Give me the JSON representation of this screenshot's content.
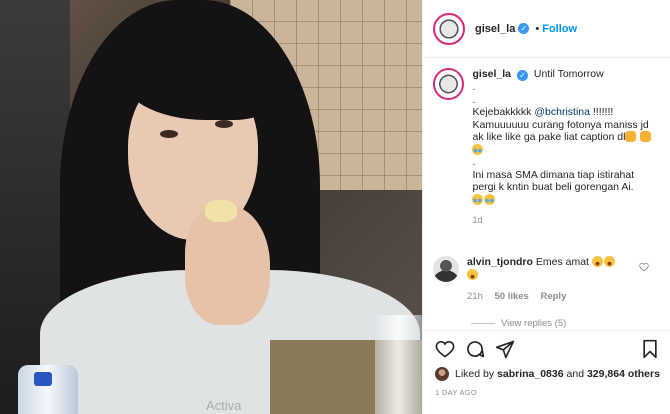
{
  "post": {
    "username": "gisel_la",
    "follow_label": "Follow",
    "dot": "•",
    "verified_mark": "✓"
  },
  "caption": {
    "username": "gisel_la",
    "line1": "Until Tomorrow",
    "dot1": ".",
    "dot2": ".",
    "text_a_pre": "Kejebakkkkk ",
    "mention": "@bchristina",
    "text_a_post": " !!!!!!! Kamuuuuuu curang fotonya maniss jd ak like like ga pake liat caption dl",
    "dot3": ".",
    "text_b": "Ini masa SMA dimana tiap istirahat pergi k kntin buat beli gorengan Ai.",
    "time": "1d"
  },
  "comment": {
    "username": "alvin_tjondro",
    "text": "Emes amat",
    "time": "21h",
    "likes": "50 likes",
    "reply": "Reply"
  },
  "view_replies": "View replies (5)",
  "likes": {
    "liked_by": "Liked by",
    "user": "sabrina_0836",
    "and": "and",
    "others": "329,864 others"
  },
  "posted_ago": "1 DAY AGO",
  "watermark": "Activa",
  "icons": [
    "heart-icon",
    "comment-icon",
    "share-icon",
    "bookmark-icon"
  ]
}
